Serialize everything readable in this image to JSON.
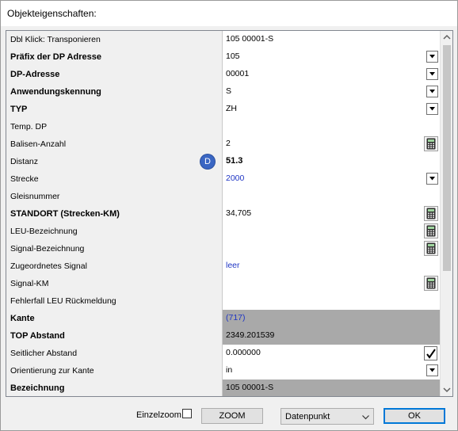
{
  "window": {
    "title": "Objekteigenschaften:"
  },
  "rows": [
    {
      "label": "Dbl Klick: Transponieren",
      "value": "105 00001-S",
      "label_bold": false,
      "control": "none",
      "value_style": "normal",
      "gray": false
    },
    {
      "label": "Präfix der DP Adresse",
      "value": "105",
      "label_bold": true,
      "control": "dropdown",
      "value_style": "normal",
      "gray": false
    },
    {
      "label": "DP-Adresse",
      "value": "00001",
      "label_bold": true,
      "control": "dropdown",
      "value_style": "normal",
      "gray": false
    },
    {
      "label": "Anwendungskennung",
      "value": "S",
      "label_bold": true,
      "control": "dropdown",
      "value_style": "normal",
      "gray": false
    },
    {
      "label": "TYP",
      "value": "ZH",
      "label_bold": true,
      "control": "dropdown",
      "value_style": "normal",
      "gray": false
    },
    {
      "label": "Temp. DP",
      "value": "",
      "label_bold": false,
      "control": "none",
      "value_style": "normal",
      "gray": false
    },
    {
      "label": "Balisen-Anzahl",
      "value": "2",
      "label_bold": false,
      "control": "calculator",
      "value_style": "normal",
      "gray": false
    },
    {
      "label": "Distanz",
      "value": "51.3",
      "label_bold": false,
      "control": "none",
      "value_style": "bold",
      "gray": false,
      "badge": "D"
    },
    {
      "label": "Strecke",
      "value": "2000",
      "label_bold": false,
      "control": "dropdown",
      "value_style": "blue",
      "gray": false
    },
    {
      "label": "Gleisnummer",
      "value": "",
      "label_bold": false,
      "control": "none",
      "value_style": "normal",
      "gray": false
    },
    {
      "label": "STANDORT (Strecken-KM)",
      "value": "34,705",
      "label_bold": true,
      "control": "calculator",
      "value_style": "normal",
      "gray": false
    },
    {
      "label": "LEU-Bezeichnung",
      "value": "",
      "label_bold": false,
      "control": "calculator",
      "value_style": "normal",
      "gray": false
    },
    {
      "label": "Signal-Bezeichnung",
      "value": "",
      "label_bold": false,
      "control": "calculator",
      "value_style": "normal",
      "gray": false
    },
    {
      "label": "Zugeordnetes Signal",
      "value": "leer",
      "label_bold": false,
      "control": "none",
      "value_style": "blue",
      "gray": false
    },
    {
      "label": "Signal-KM",
      "value": "",
      "label_bold": false,
      "control": "calculator",
      "value_style": "normal",
      "gray": false
    },
    {
      "label": "Fehlerfall LEU Rückmeldung",
      "value": "",
      "label_bold": false,
      "control": "none",
      "value_style": "normal",
      "gray": false
    },
    {
      "label": "Kante",
      "value": "(717)",
      "label_bold": true,
      "control": "none",
      "value_style": "blue",
      "gray": true
    },
    {
      "label": "TOP Abstand",
      "value": "2349.201539",
      "label_bold": true,
      "control": "none",
      "value_style": "normal",
      "gray": true
    },
    {
      "label": "Seitlicher Abstand",
      "value": "0.000000",
      "label_bold": false,
      "control": "check",
      "value_style": "normal",
      "gray": false
    },
    {
      "label": "Orientierung zur Kante",
      "value": "in",
      "label_bold": false,
      "control": "dropdown",
      "value_style": "normal",
      "gray": false
    },
    {
      "label": "Bezeichnung",
      "value": "105 00001-S",
      "label_bold": true,
      "control": "none",
      "value_style": "normal",
      "gray": true
    }
  ],
  "footer": {
    "einzelzoom_label": "Einzelzoom",
    "einzelzoom_checked": false,
    "zoom_label": "ZOOM",
    "type_select_value": "Datenpunkt",
    "ok_label": "OK"
  },
  "icons": {
    "dropdown": "chevron-down-icon",
    "calculator": "calculator-icon",
    "check": "checkmark-icon"
  },
  "colors": {
    "blue_value": "#1f35c4",
    "badge": "#3a66c3",
    "gray_value_bg": "#a9a9a9"
  }
}
